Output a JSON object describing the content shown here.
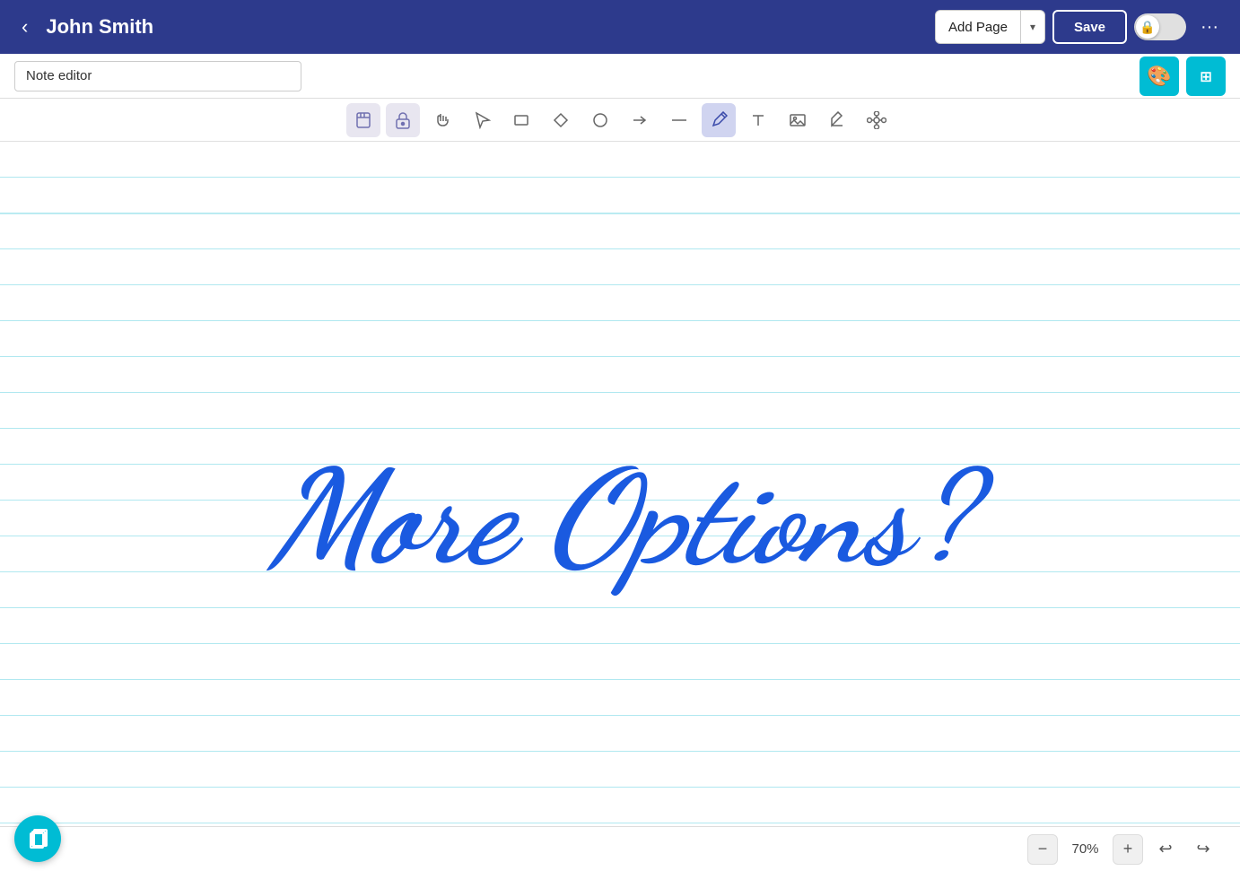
{
  "header": {
    "back_label": "‹",
    "title": "John Smith",
    "add_page_label": "Add Page",
    "save_label": "Save",
    "more_label": "···"
  },
  "note_editor": {
    "placeholder": "Note editor",
    "value": "Note editor"
  },
  "toolbar": {
    "tools": [
      {
        "name": "sticky-note-icon",
        "icon": "🗒",
        "active": true
      },
      {
        "name": "lock-icon",
        "icon": "🔒",
        "active": true
      },
      {
        "name": "hand-icon",
        "icon": "✋",
        "active": false
      },
      {
        "name": "select-icon",
        "icon": "↖",
        "active": false
      },
      {
        "name": "rect-icon",
        "icon": "□",
        "active": false
      },
      {
        "name": "diamond-icon",
        "icon": "◇",
        "active": false
      },
      {
        "name": "circle-icon",
        "icon": "○",
        "active": false
      },
      {
        "name": "arrow-icon",
        "icon": "→",
        "active": false
      },
      {
        "name": "line-icon",
        "icon": "—",
        "active": false
      },
      {
        "name": "pen-icon",
        "icon": "✏",
        "active": true,
        "active_type": "blue"
      },
      {
        "name": "text-icon",
        "icon": "A",
        "active": false
      },
      {
        "name": "image-icon",
        "icon": "🖼",
        "active": false
      },
      {
        "name": "eraser-icon",
        "icon": "◈",
        "active": false
      },
      {
        "name": "diagram-icon",
        "icon": "⬡",
        "active": false
      }
    ]
  },
  "canvas": {
    "handwriting_text": "More Options?",
    "zoom_level": "70%"
  },
  "bottom_bar": {
    "zoom_minus": "−",
    "zoom_plus": "+",
    "zoom_level": "70%",
    "undo_icon": "↩",
    "redo_icon": "↪",
    "pages_icon": "❐"
  },
  "teal_buttons": {
    "palette_icon": "🎨",
    "grid_icon": "⊞"
  }
}
